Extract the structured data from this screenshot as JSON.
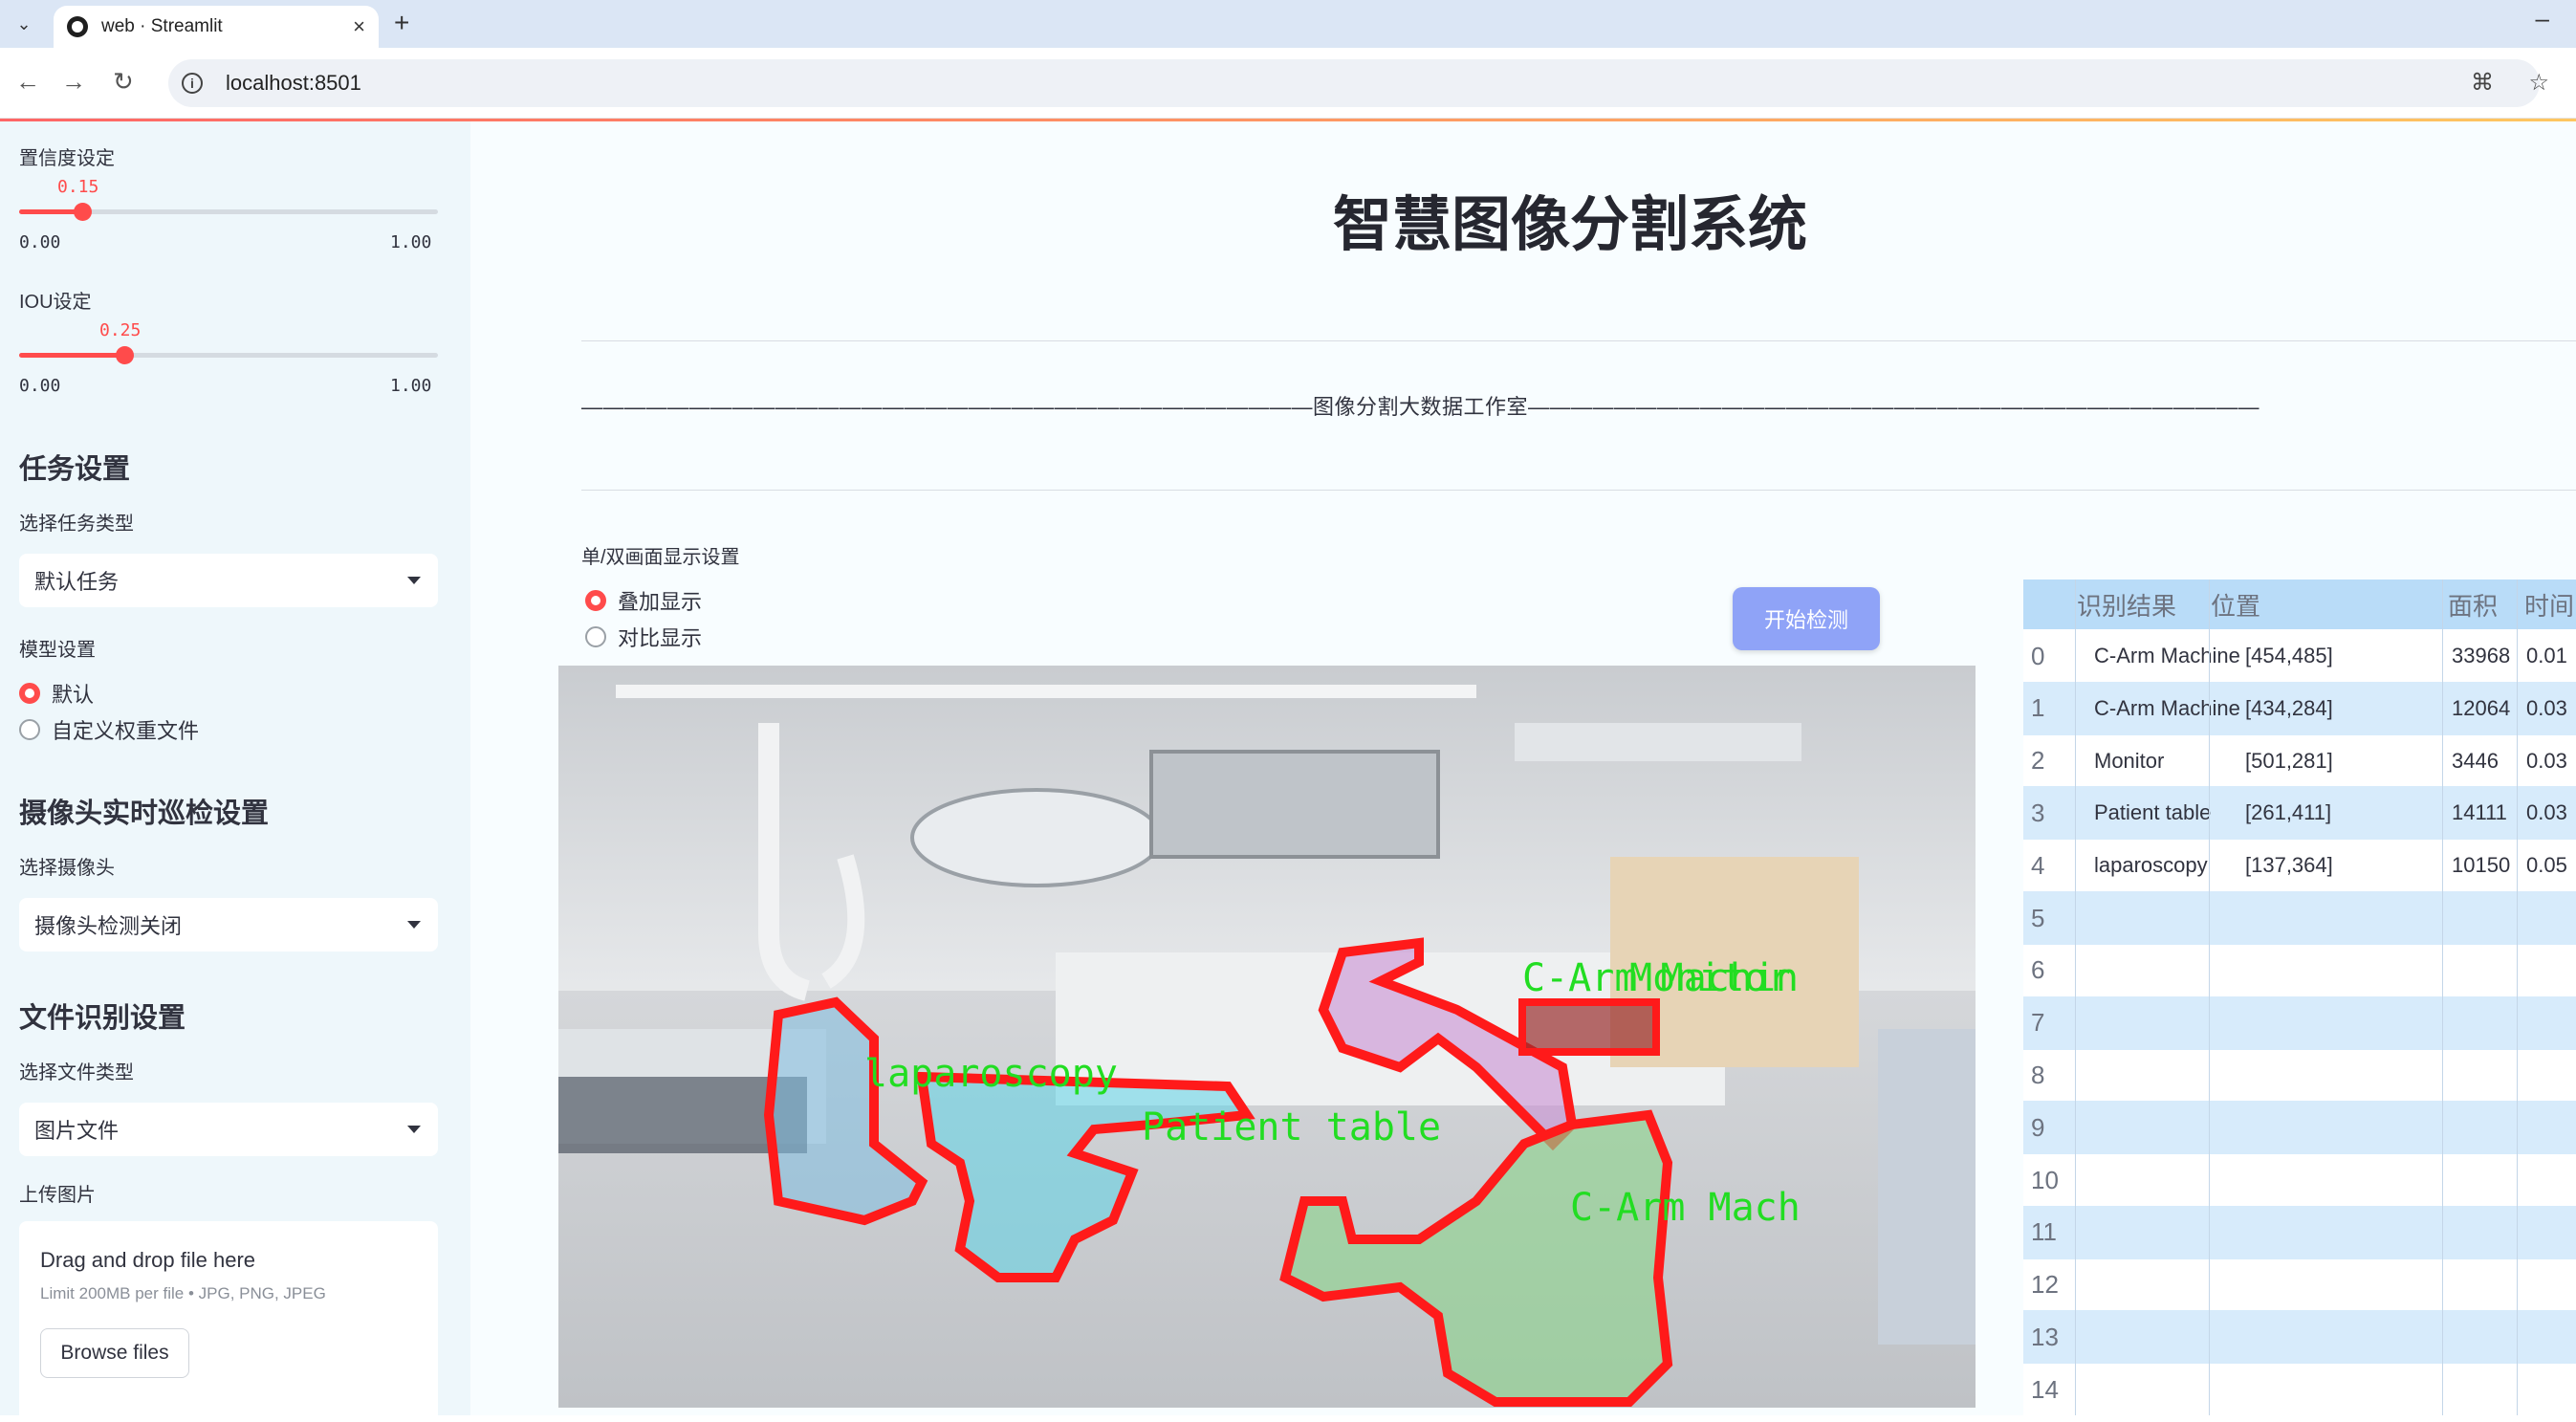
{
  "browser": {
    "tab_title": "web · Streamlit",
    "url": "localhost:8501"
  },
  "sidebar": {
    "confidence": {
      "label": "置信度设定",
      "value": "0.15",
      "value_num": 0.15,
      "min": "0.00",
      "max": "1.00"
    },
    "iou": {
      "label": "IOU设定",
      "value": "0.25",
      "value_num": 0.25,
      "min": "0.00",
      "max": "1.00"
    },
    "task_heading": "任务设置",
    "task_type_label": "选择任务类型",
    "task_type_value": "默认任务",
    "model_label": "模型设置",
    "model_options": [
      "默认",
      "自定义权重文件"
    ],
    "model_selected": "默认",
    "camera_heading": "摄像头实时巡检设置",
    "camera_label": "选择摄像头",
    "camera_value": "摄像头检测关闭",
    "file_heading": "文件识别设置",
    "file_type_label": "选择文件类型",
    "file_type_value": "图片文件",
    "upload_label": "上传图片",
    "dropzone_title": "Drag and drop file here",
    "dropzone_sub": "Limit 200MB per file • JPG, PNG, JPEG",
    "browse_label": "Browse files"
  },
  "main": {
    "title": "智慧图像分割系统",
    "studio_line": "——————————————————————————————————图像分割大数据工作室——————————————————————————————————",
    "display_mode_label": "单/双画面显示设置",
    "display_options": [
      "叠加显示",
      "对比显示"
    ],
    "display_selected": "叠加显示",
    "start_button": "开始检测"
  },
  "overlay_labels": [
    {
      "text": "C-Arm Machin",
      "color": "#22dd22"
    },
    {
      "text": "Monitor",
      "color": "#22dd22"
    },
    {
      "text": "laparoscopy",
      "color": "#22dd22"
    },
    {
      "text": "Patient table",
      "color": "#22dd22"
    },
    {
      "text": "C-Arm Mach",
      "color": "#22dd22"
    }
  ],
  "results_table": {
    "columns": [
      "识别结果",
      "位置",
      "面积",
      "时间"
    ],
    "rows": [
      {
        "idx": "0",
        "result": "C-Arm Machine",
        "position": "[454,485]",
        "area": "33968",
        "time": "0.01"
      },
      {
        "idx": "1",
        "result": "C-Arm Machine",
        "position": "[434,284]",
        "area": "12064",
        "time": "0.03"
      },
      {
        "idx": "2",
        "result": "Monitor",
        "position": "[501,281]",
        "area": "3446",
        "time": "0.03"
      },
      {
        "idx": "3",
        "result": "Patient table",
        "position": "[261,411]",
        "area": "14111",
        "time": "0.03"
      },
      {
        "idx": "4",
        "result": "laparoscopy",
        "position": "[137,364]",
        "area": "10150",
        "time": "0.05"
      },
      {
        "idx": "5"
      },
      {
        "idx": "6"
      },
      {
        "idx": "7"
      },
      {
        "idx": "8"
      },
      {
        "idx": "9"
      },
      {
        "idx": "10"
      },
      {
        "idx": "11"
      },
      {
        "idx": "12"
      },
      {
        "idx": "13"
      },
      {
        "idx": "14"
      }
    ]
  },
  "colors": {
    "accent": "#ff4b4b",
    "sidebar_bg": "#eef7fb",
    "button_bg": "#8fa3f7",
    "mask_outline": "#ff1a1a"
  }
}
